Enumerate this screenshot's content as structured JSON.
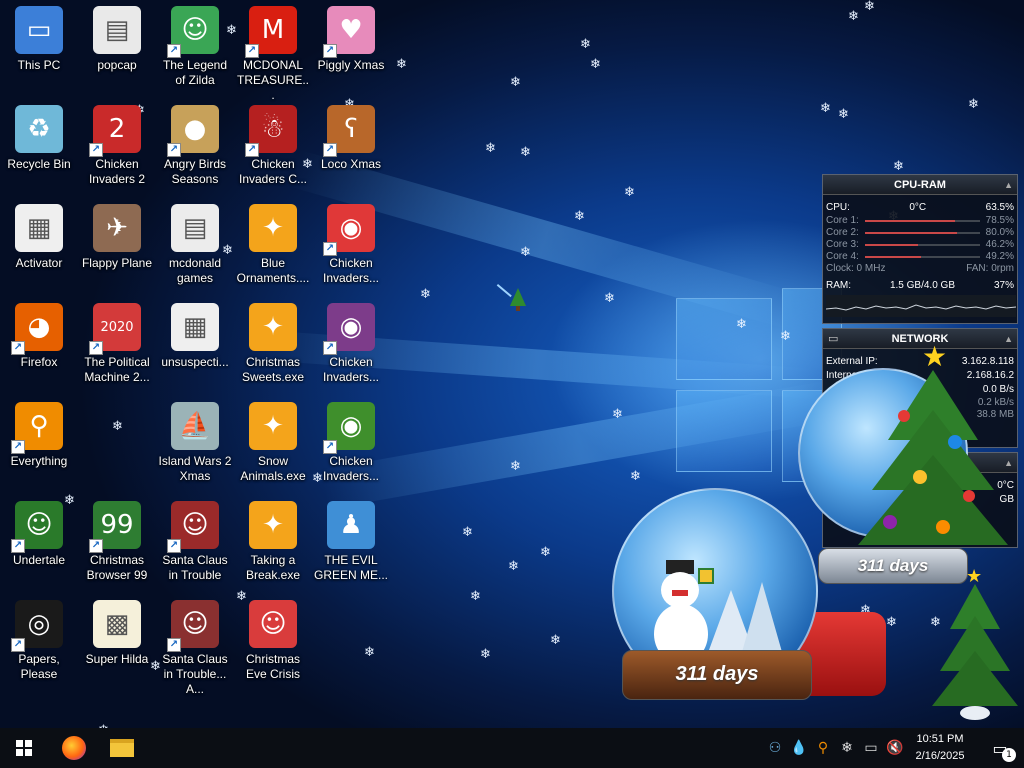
{
  "desktop": {
    "icons": [
      {
        "label": "This PC",
        "icon": "computer-icon",
        "color": "#3c7fd8",
        "glyph": "▭",
        "shortcut": false
      },
      {
        "label": "popcap",
        "icon": "folder-icon",
        "color": "#e9e9e9",
        "glyph": "▤",
        "shortcut": false
      },
      {
        "label": "The Legend of Zilda",
        "icon": "game-legend-zilda-icon",
        "color": "#3aa655",
        "glyph": "☺",
        "shortcut": true
      },
      {
        "label": "MCDONAL TREASURE...",
        "icon": "mcdonalds-logo-icon",
        "color": "#d91f11",
        "glyph": "M",
        "shortcut": true
      },
      {
        "label": "Piggly Xmas",
        "icon": "pig-icon",
        "color": "#e78bbb",
        "glyph": "♥",
        "shortcut": true
      },
      {
        "label": "Recycle Bin",
        "icon": "recycle-bin-icon",
        "color": "#6fb8d8",
        "glyph": "♻",
        "shortcut": false
      },
      {
        "label": "Chicken Invaders 2",
        "icon": "chicken-icon",
        "color": "#c92a2a",
        "glyph": "2",
        "shortcut": true
      },
      {
        "label": "Angry Birds Seasons",
        "icon": "angry-birds-icon",
        "color": "#c7a15a",
        "glyph": "●",
        "shortcut": true
      },
      {
        "label": "Chicken Invaders C...",
        "icon": "chicken-santa-icon",
        "color": "#b52020",
        "glyph": "☃",
        "shortcut": true
      },
      {
        "label": "Loco Xmas",
        "icon": "teddy-bear-icon",
        "color": "#b8672a",
        "glyph": "ʕ",
        "shortcut": true
      },
      {
        "label": "Activator",
        "icon": "file-icon",
        "color": "#efefef",
        "glyph": "▦",
        "shortcut": false
      },
      {
        "label": "Flappy Plane",
        "icon": "flappy-plane-icon",
        "color": "#8e6a52",
        "glyph": "✈",
        "shortcut": false
      },
      {
        "label": "mcdonald games",
        "icon": "folder-icon",
        "color": "#ececec",
        "glyph": "▤",
        "shortcut": false
      },
      {
        "label": "Blue Ornaments....",
        "icon": "puzzle-exe-icon",
        "color": "#f4a41b",
        "glyph": "✦",
        "shortcut": false
      },
      {
        "label": "Chicken Invaders...",
        "icon": "chicken-invaders-icon",
        "color": "#e03838",
        "glyph": "◉",
        "shortcut": true
      },
      {
        "label": "Firefox",
        "icon": "firefox-icon",
        "color": "#e66000",
        "glyph": "◕",
        "shortcut": true
      },
      {
        "label": "The Political Machine 2...",
        "icon": "political-machine-icon",
        "color": "#d33a3a",
        "glyph": "2020",
        "shortcut": true
      },
      {
        "label": "unsuspecti...",
        "icon": "file-icon",
        "color": "#efefef",
        "glyph": "▦",
        "shortcut": false
      },
      {
        "label": "Christmas Sweets.exe",
        "icon": "puzzle-exe-icon",
        "color": "#f4a41b",
        "glyph": "✦",
        "shortcut": false
      },
      {
        "label": "Chicken Invaders...",
        "icon": "chicken-invaders-icon",
        "color": "#7d3c8a",
        "glyph": "◉",
        "shortcut": true
      },
      {
        "label": "Everything",
        "icon": "search-magnifier-icon",
        "color": "#f08c00",
        "glyph": "⚲",
        "shortcut": true
      },
      {
        "label": "",
        "icon": "",
        "color": "",
        "glyph": "",
        "shortcut": false
      },
      {
        "label": "Island Wars 2 Xmas",
        "icon": "island-wars-icon",
        "color": "#9bb3b7",
        "glyph": "⛵",
        "shortcut": false
      },
      {
        "label": "Snow Animals.exe",
        "icon": "puzzle-exe-icon",
        "color": "#f4a41b",
        "glyph": "✦",
        "shortcut": false
      },
      {
        "label": "Chicken Invaders...",
        "icon": "chicken-invaders-icon",
        "color": "#3f8f2c",
        "glyph": "◉",
        "shortcut": true
      },
      {
        "label": "Undertale",
        "icon": "undertale-icon",
        "color": "#2a7a2a",
        "glyph": "☺",
        "shortcut": true
      },
      {
        "label": "Christmas Browser 99",
        "icon": "christmas-tree-icon",
        "color": "#2e7d32",
        "glyph": "99",
        "shortcut": true
      },
      {
        "label": "Santa Claus in Trouble",
        "icon": "santa-icon",
        "color": "#9b2a2a",
        "glyph": "☺",
        "shortcut": true
      },
      {
        "label": "Taking a Break.exe",
        "icon": "puzzle-exe-icon",
        "color": "#f4a41b",
        "glyph": "✦",
        "shortcut": false
      },
      {
        "label": "THE EVIL GREEN ME...",
        "icon": "evil-green-messenger-icon",
        "color": "#3f8fd6",
        "glyph": "♟",
        "shortcut": false
      },
      {
        "label": "Papers, Please",
        "icon": "papers-please-icon",
        "color": "#1a1a1a",
        "glyph": "◎",
        "shortcut": true
      },
      {
        "label": "Super Hilda",
        "icon": "super-hilda-icon",
        "color": "#f5f0da",
        "glyph": "▩",
        "shortcut": false
      },
      {
        "label": "Santa Claus in Trouble... A...",
        "icon": "santa-icon",
        "color": "#8a3030",
        "glyph": "☺",
        "shortcut": true
      },
      {
        "label": "Christmas Eve Crisis",
        "icon": "santa-icon",
        "color": "#d93c3c",
        "glyph": "☺",
        "shortcut": false
      }
    ]
  },
  "cpu_gadget": {
    "title": "CPU-RAM",
    "cpu_label": "CPU:",
    "cpu_temp": "0°C",
    "cpu_percent": "63.5%",
    "cores": [
      {
        "label": "Core 1:",
        "value": "78.5%",
        "level": 0.785
      },
      {
        "label": "Core 2:",
        "value": "80.0%",
        "level": 0.8
      },
      {
        "label": "Core 3:",
        "value": "46.2%",
        "level": 0.462
      },
      {
        "label": "Core 4:",
        "value": "49.2%",
        "level": 0.492
      }
    ],
    "clock": "Clock: 0 MHz",
    "fan": "FAN: 0rpm",
    "ram_label": "RAM:",
    "ram_usage": "1.5 GB/4.0 GB",
    "ram_percent": "37%"
  },
  "network_gadget": {
    "title": "NETWORK",
    "external_ip_label": "External IP:",
    "external_ip": "3.162.8.118",
    "internal_ip_label": "Interna",
    "internal_ip": "2.168.16.2",
    "rate_1": "0.0 B/s",
    "rate_2": "0.2 kB/s",
    "total": "38.8 MB"
  },
  "partial_gadget": {
    "temp": "0°C",
    "unit": "GB"
  },
  "snow_globes": [
    {
      "text": "311 days"
    },
    {
      "text": "311 days"
    }
  ],
  "taskbar": {
    "time": "10:51 PM",
    "date": "2/16/2025",
    "notification_count": "1",
    "tray_icons": [
      "people-icon",
      "droplet-icon",
      "search-magnifier-icon",
      "snowflake-icon",
      "network-icon",
      "volume-muted-icon"
    ]
  },
  "colors": {
    "taskbar_bg": "#0b0e14",
    "desktop_blue": "#1763c9",
    "gadget_bg": "#0a0e18"
  }
}
